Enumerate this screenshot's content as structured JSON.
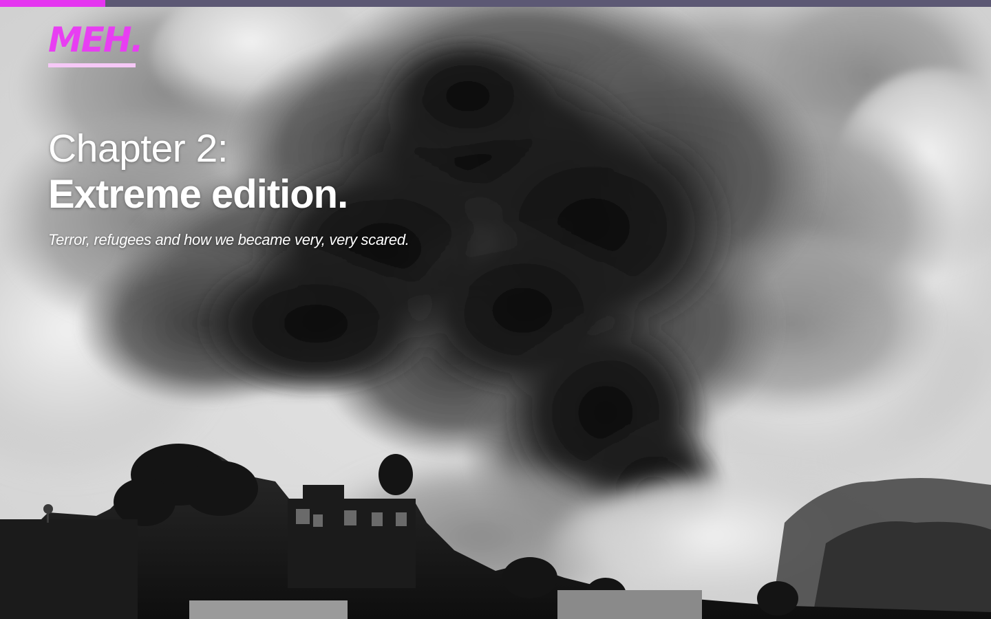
{
  "progress": {
    "fraction": 0.106,
    "track_color": "#5c5874",
    "fill_color": "#e535f0"
  },
  "logo": {
    "text": "MEH.",
    "color": "#e83ef2",
    "underline_color": "#f6c8f7"
  },
  "hero": {
    "chapter": "Chapter 2:",
    "title": "Extreme edition.",
    "subtitle": "Terror, refugees and how we became very, very scared."
  },
  "background": {
    "subject": "explosion-smoke-photo",
    "tone": "black-and-white"
  }
}
